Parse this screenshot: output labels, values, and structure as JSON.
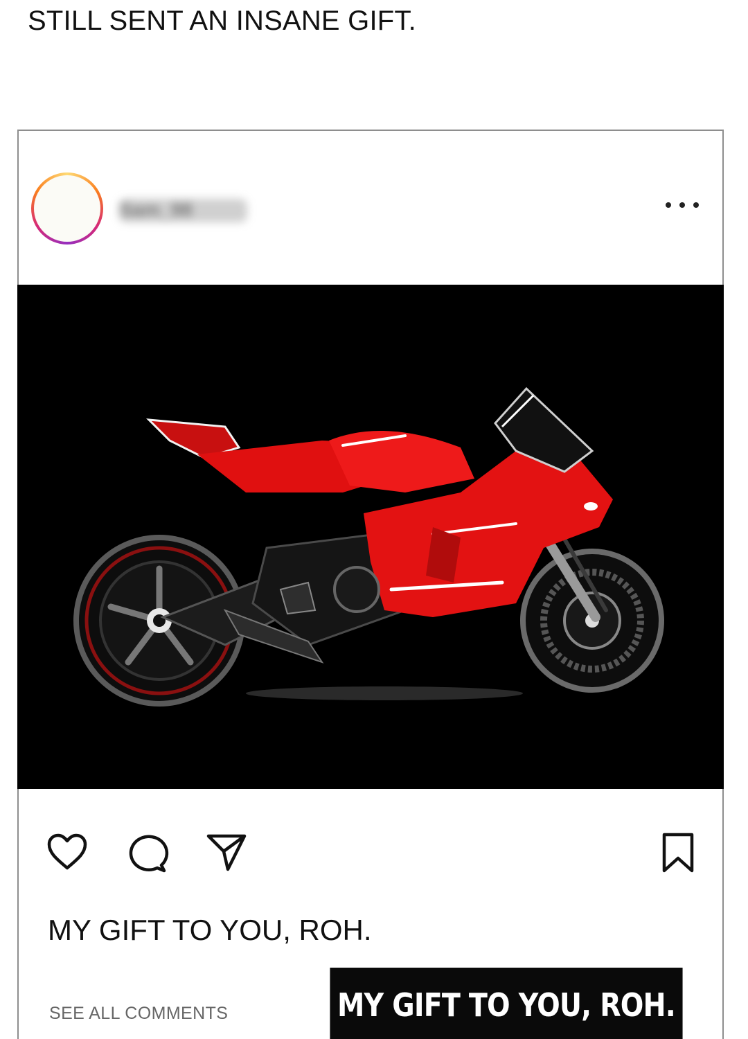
{
  "headline": "STILL SENT AN INSANE GIFT.",
  "post": {
    "username": "Sam_98",
    "more_icon": "more-horizontal-icon",
    "image_alt": "red sport motorcycle on black background",
    "actions": {
      "like_icon": "heart-icon",
      "comment_icon": "comment-icon",
      "share_icon": "send-icon",
      "save_icon": "bookmark-icon"
    },
    "caption": "MY GIFT TO YOU, ROH.",
    "see_all_comments": "SEE ALL COMMENTS",
    "banner_text": "MY GIFT TO YOU, ROH."
  },
  "colors": {
    "bike_red": "#e01010",
    "image_bg": "#000000",
    "avatar_ring": "#d62976"
  }
}
